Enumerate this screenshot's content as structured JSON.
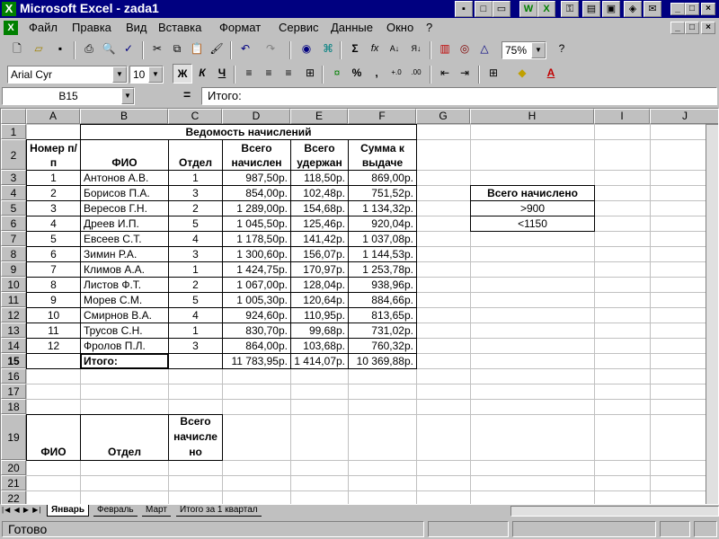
{
  "window": {
    "title": "Microsoft Excel - zada1",
    "min": "_",
    "max": "□",
    "close": "×"
  },
  "menu": [
    "Файл",
    "Правка",
    "Вид",
    "Вставка",
    "Формат",
    "Сервис",
    "Данные",
    "Окно",
    "?"
  ],
  "toolbar": {
    "zoom": "75%",
    "font": "Arial Cyr",
    "size": "10"
  },
  "formula_bar": {
    "cell_ref": "B15",
    "equals": "=",
    "content": "Итого:"
  },
  "columns": [
    "A",
    "B",
    "C",
    "D",
    "E",
    "F",
    "G",
    "H",
    "I",
    "J"
  ],
  "rows": [
    "1",
    "2",
    "3",
    "4",
    "5",
    "6",
    "7",
    "8",
    "9",
    "10",
    "11",
    "12",
    "13",
    "14",
    "15",
    "16",
    "17",
    "18",
    "19",
    "20",
    "21",
    "22"
  ],
  "table": {
    "title": "Ведомость начислений",
    "headers": {
      "num": "Номер п/п",
      "fio": "ФИО",
      "dept": "Отдел",
      "accrued": "Всего начислен",
      "withheld": "Всего удержан",
      "payout": "Сумма к выдаче"
    },
    "rows": [
      [
        "1",
        "Антонов А.В.",
        "1",
        "987,50р.",
        "118,50р.",
        "869,00р."
      ],
      [
        "2",
        "Борисов П.А.",
        "3",
        "854,00р.",
        "102,48р.",
        "751,52р."
      ],
      [
        "3",
        "Вересов Г.Н.",
        "2",
        "1 289,00р.",
        "154,68р.",
        "1 134,32р."
      ],
      [
        "4",
        "Дреев И.П.",
        "5",
        "1 045,50р.",
        "125,46р.",
        "920,04р."
      ],
      [
        "5",
        "Евсеев С.Т.",
        "4",
        "1 178,50р.",
        "141,42р.",
        "1 037,08р."
      ],
      [
        "6",
        "Зимин Р.А.",
        "3",
        "1 300,60р.",
        "156,07р.",
        "1 144,53р."
      ],
      [
        "7",
        "Климов А.А.",
        "1",
        "1 424,75р.",
        "170,97р.",
        "1 253,78р."
      ],
      [
        "8",
        "Листов Ф.Т.",
        "2",
        "1 067,00р.",
        "128,04р.",
        "938,96р."
      ],
      [
        "9",
        "Морев С.М.",
        "5",
        "1 005,30р.",
        "120,64р.",
        "884,66р."
      ],
      [
        "10",
        "Смирнов В.А.",
        "4",
        "924,60р.",
        "110,95р.",
        "813,65р."
      ],
      [
        "11",
        "Трусов С.Н.",
        "1",
        "830,70р.",
        "99,68р.",
        "731,02р."
      ],
      [
        "12",
        "Фролов П.Л.",
        "3",
        "864,00р.",
        "103,68р.",
        "760,32р."
      ]
    ],
    "total": {
      "label": "Итого:",
      "accrued": "11 783,95р.",
      "withheld": "1 414,07р.",
      "payout": "10 369,88р."
    }
  },
  "criteria": {
    "header": "Всего начислено",
    "c1": ">900",
    "c2": "<1150"
  },
  "extract_headers": {
    "fio": "ФИО",
    "dept": "Отдел",
    "accrued": "Всего начисле но"
  },
  "sheets": [
    "Январь",
    "Февраль",
    "Март",
    "Итого за 1 квартал"
  ],
  "active_sheet": "Январь",
  "status": "Готово"
}
